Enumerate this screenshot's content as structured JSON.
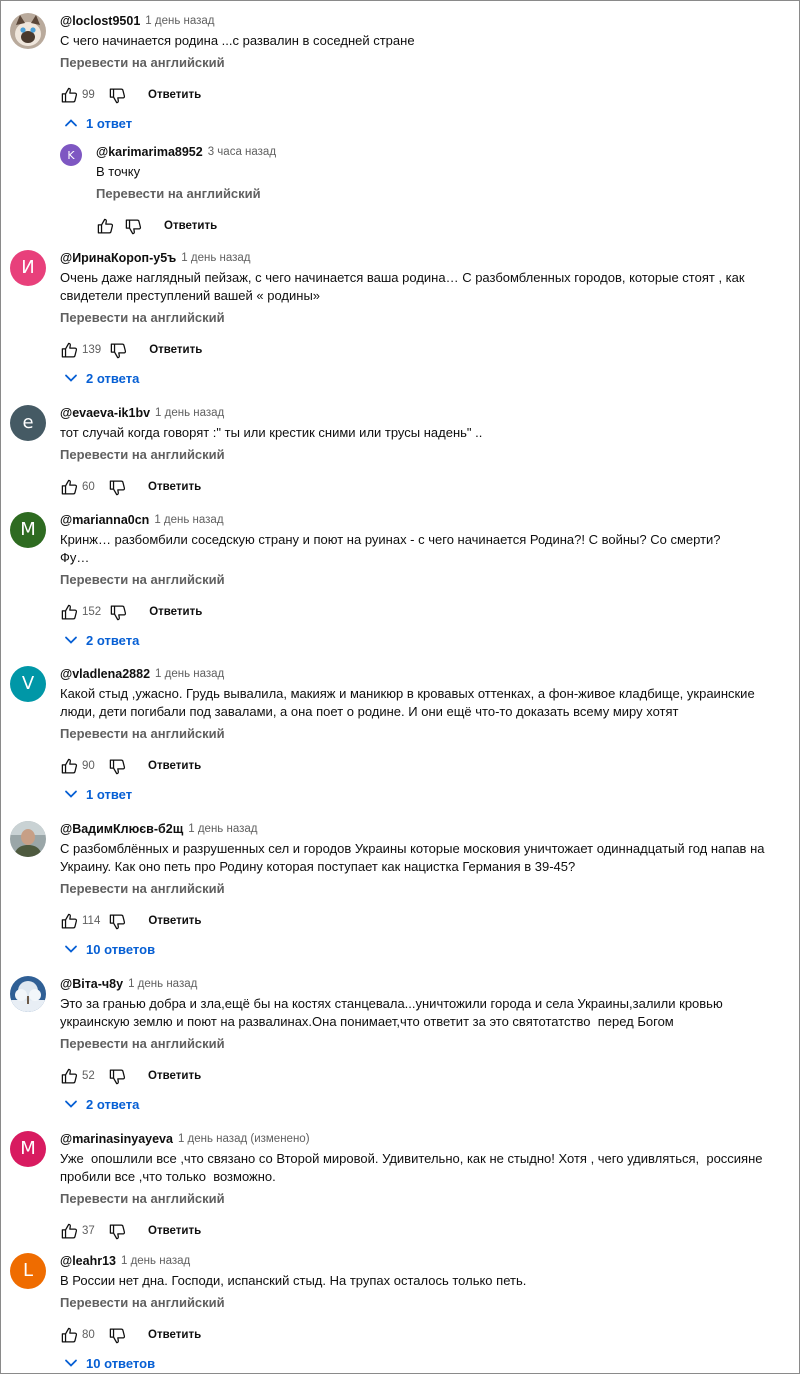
{
  "ui": {
    "translate_label": "Перевести на английский",
    "reply_label": "Ответить"
  },
  "comments": [
    {
      "author": "@loclost9501",
      "date": "1 день назад",
      "text": "С чего начинается родина ...с развалин в соседней стране",
      "likes": "99",
      "avatar": {
        "kind": "cat",
        "letter": "",
        "color": "#9a8a7e"
      },
      "replies_toggle": {
        "label": "1 ответ",
        "expanded": true
      },
      "replies": [
        {
          "author": "@karimarima8952",
          "date": "3 часа назад",
          "text": "В точку",
          "likes": "",
          "avatar": {
            "kind": "letter",
            "letter": "K",
            "color": "#7e57c2"
          }
        }
      ]
    },
    {
      "author": "@ИринаКороп-у5ъ",
      "date": "1 день назад",
      "text": "Очень даже наглядный пейзаж, с чего начинается ваша родина… С разбомбленных городов, которые стоят , как свидетели преступлений вашей « родины»",
      "likes": "139",
      "avatar": {
        "kind": "letter",
        "letter": "И",
        "color": "#e8407b"
      },
      "replies_toggle": {
        "label": "2 ответа",
        "expanded": false
      }
    },
    {
      "author": "@evaeva-ik1bv",
      "date": "1 день назад",
      "text": "тот случай когда говорят :\" ты или крестик сними или трусы надень\" ..",
      "likes": "60",
      "avatar": {
        "kind": "letter",
        "letter": "e",
        "color": "#455a64"
      }
    },
    {
      "author": "@marianna0cn",
      "date": "1 день назад",
      "text": "Кринж… разбомбили соседскую страну и поют на руинах - с чего начинается Родина?! С войны? Со смерти?\nФу…",
      "likes": "152",
      "avatar": {
        "kind": "letter",
        "letter": "M",
        "color": "#2e6b21"
      },
      "replies_toggle": {
        "label": "2 ответа",
        "expanded": false
      }
    },
    {
      "author": "@vladlena2882",
      "date": "1 день назад",
      "text": "Какой стыд ,ужасно. Грудь вывалила, макияж и маникюр в кровавых оттенках, а фон-живое кладбище, украинские люди, дети погибали под завалами, а она поет о родине. И они ещё что-то доказать всему миру хотят",
      "likes": "90",
      "avatar": {
        "kind": "letter",
        "letter": "V",
        "color": "#0097a7"
      },
      "replies_toggle": {
        "label": "1 ответ",
        "expanded": false
      }
    },
    {
      "author": "@ВадимКлюєв-б2щ",
      "date": "1 день назад",
      "text": "С разбомблённых и разрушенных сел и городов Украины которые московия уничтожает одиннадцатый год напав на Украину. Как оно петь про Родину которая поступает как нацистка Германия в 39-45?",
      "likes": "114",
      "avatar": {
        "kind": "photo-man",
        "letter": "",
        "color": "#8d9aa0"
      },
      "replies_toggle": {
        "label": "10 ответов",
        "expanded": false
      }
    },
    {
      "author": "@Віта-ч8у",
      "date": "1 день назад",
      "text": "Это за гранью добра и зла,ещё бы на костях станцевала...уничтожили города и села Украины,залили кровью украинскую землю и поют на развалинах.Она понимает,что ответит за это святотатство  перед Богом",
      "likes": "52",
      "avatar": {
        "kind": "photo-tree",
        "letter": "",
        "color": "#5f86b0"
      },
      "replies_toggle": {
        "label": "2 ответа",
        "expanded": false
      }
    },
    {
      "author": "@marinasinyayeva",
      "date": "1 день назад (изменено)",
      "text": "Уже  опошлили все ,что связано со Второй мировой. Удивительно, как не стыдно! Хотя , чего удивляться,  россияне пробили все ,что только  возможно.",
      "likes": "37",
      "avatar": {
        "kind": "letter",
        "letter": "M",
        "color": "#d81b60"
      }
    },
    {
      "author": "@leahr13",
      "date": "1 день назад",
      "text": "В России нет дна. Господи, испанский стыд. На трупах осталось только петь.",
      "likes": "80",
      "avatar": {
        "kind": "letter",
        "letter": "L",
        "color": "#ef6c00"
      },
      "replies_toggle": {
        "label": "10 ответов",
        "expanded": false
      }
    }
  ]
}
